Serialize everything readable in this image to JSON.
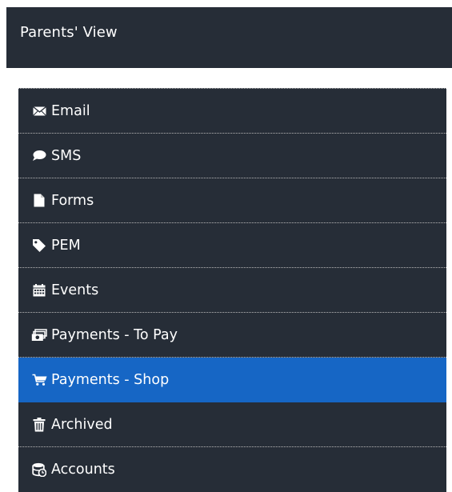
{
  "header": {
    "title": "Parents' View"
  },
  "menu": {
    "items": [
      {
        "label": "Email",
        "icon": "envelope-icon"
      },
      {
        "label": "SMS",
        "icon": "speech-bubble-icon"
      },
      {
        "label": "Forms",
        "icon": "document-icon"
      },
      {
        "label": "PEM",
        "icon": "tag-icon"
      },
      {
        "label": "Events",
        "icon": "calendar-icon"
      },
      {
        "label": "Payments - To Pay",
        "icon": "money-icon"
      },
      {
        "label": "Payments - Shop",
        "icon": "shopping-cart-icon",
        "active": true
      },
      {
        "label": "Archived",
        "icon": "trash-icon"
      },
      {
        "label": "Accounts",
        "icon": "database-icon"
      }
    ]
  },
  "colors": {
    "background": "#262d37",
    "active": "#1666c5",
    "text": "#ffffff"
  }
}
